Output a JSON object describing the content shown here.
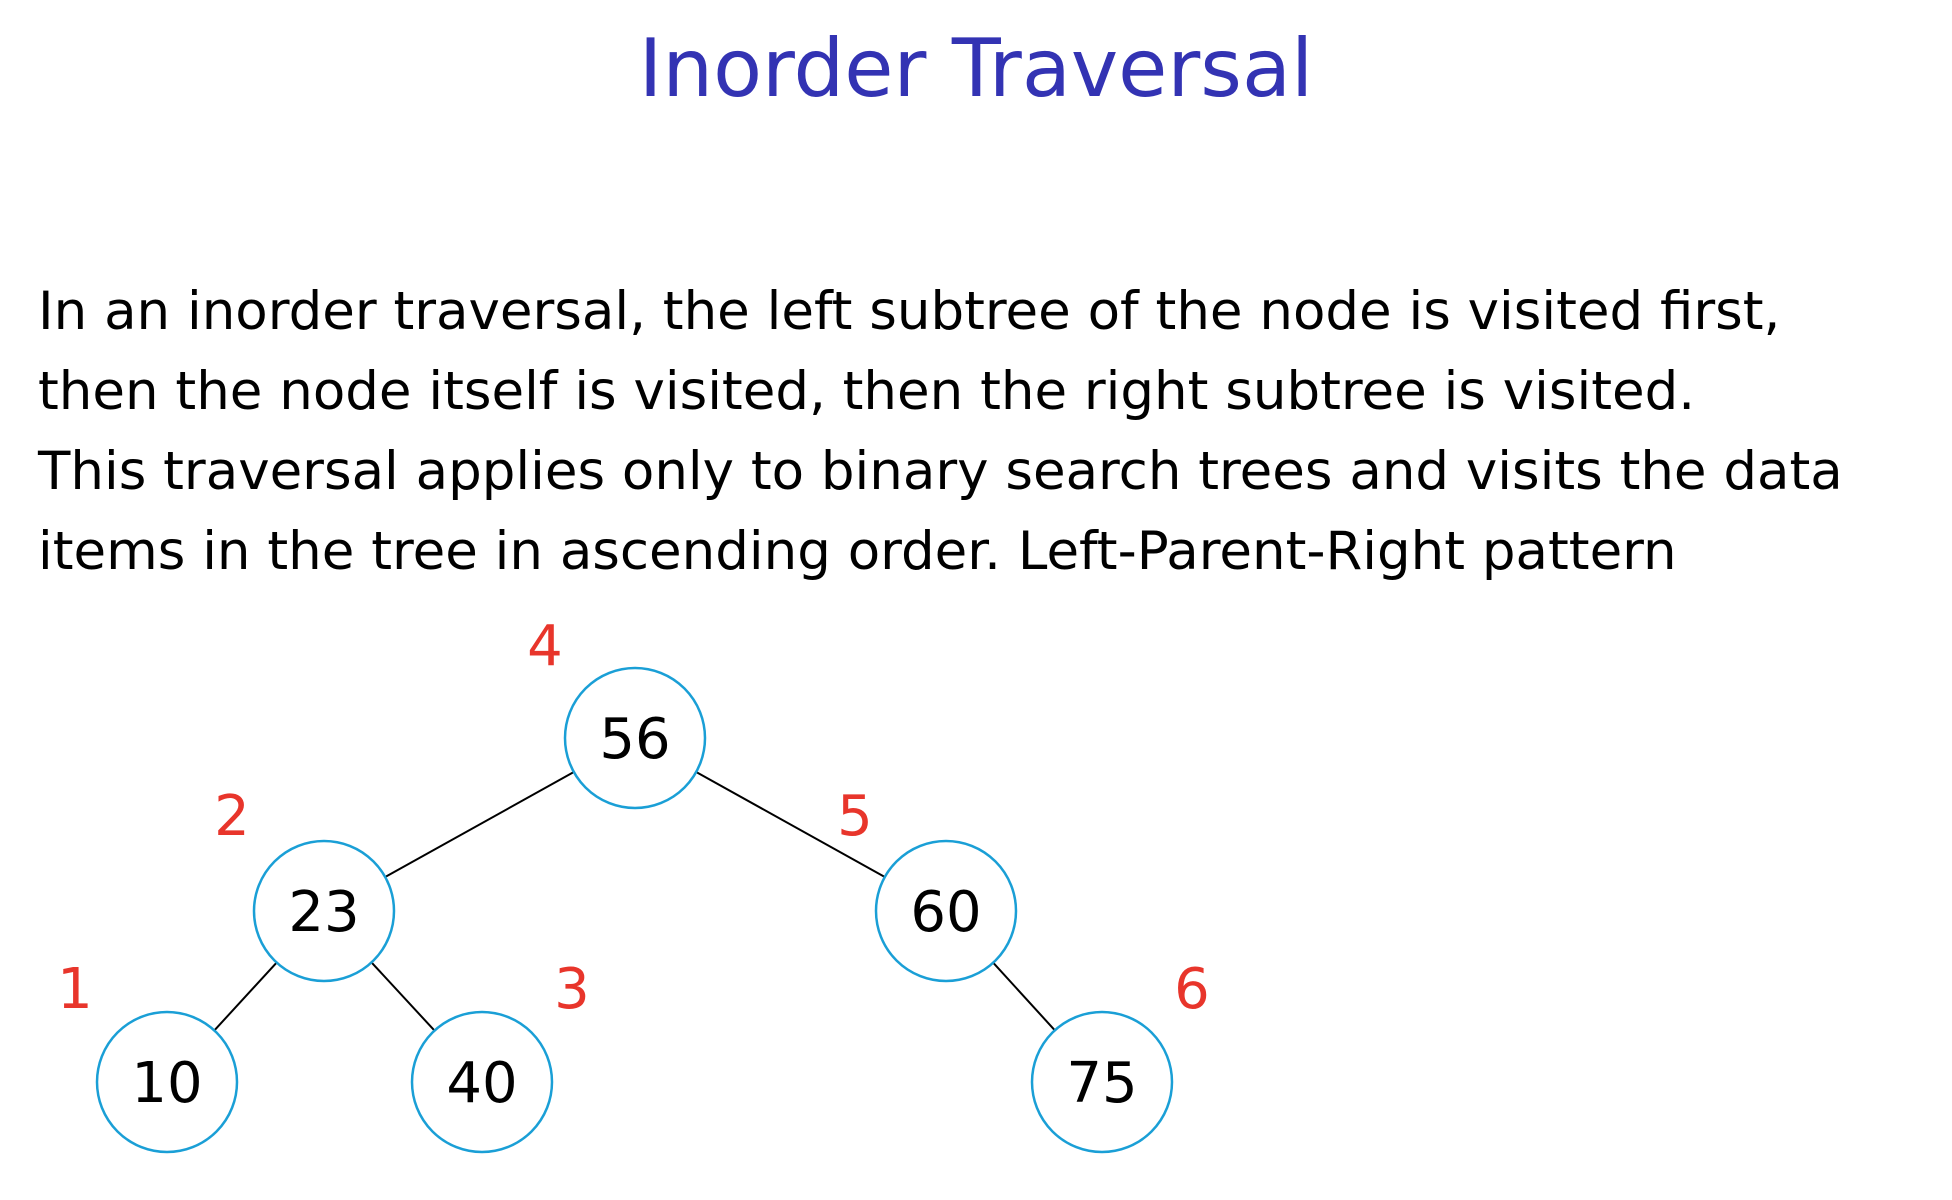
{
  "title": "Inorder Traversal",
  "paragraph_lines": [
    "In an inorder traversal, the left subtree of the node is visited first,",
    "then the node itself is visited, then the right subtree is visited.",
    "This traversal applies only to binary search trees and visits the data",
    "items in the tree in ascending order. Left-Parent-Right pattern"
  ],
  "colors": {
    "title": "#3333b3",
    "node_stroke": "#1a9fd6",
    "order_label": "#e8352b",
    "edge": "#000000"
  },
  "tree": {
    "nodes": [
      {
        "id": "n56",
        "value": "56",
        "order": "4"
      },
      {
        "id": "n23",
        "value": "23",
        "order": "2"
      },
      {
        "id": "n60",
        "value": "60",
        "order": "5"
      },
      {
        "id": "n10",
        "value": "10",
        "order": "1"
      },
      {
        "id": "n40",
        "value": "40",
        "order": "3"
      },
      {
        "id": "n75",
        "value": "75",
        "order": "6"
      }
    ],
    "edges": [
      [
        "n56",
        "n23"
      ],
      [
        "n56",
        "n60"
      ],
      [
        "n23",
        "n10"
      ],
      [
        "n23",
        "n40"
      ],
      [
        "n60",
        "n75"
      ]
    ]
  }
}
